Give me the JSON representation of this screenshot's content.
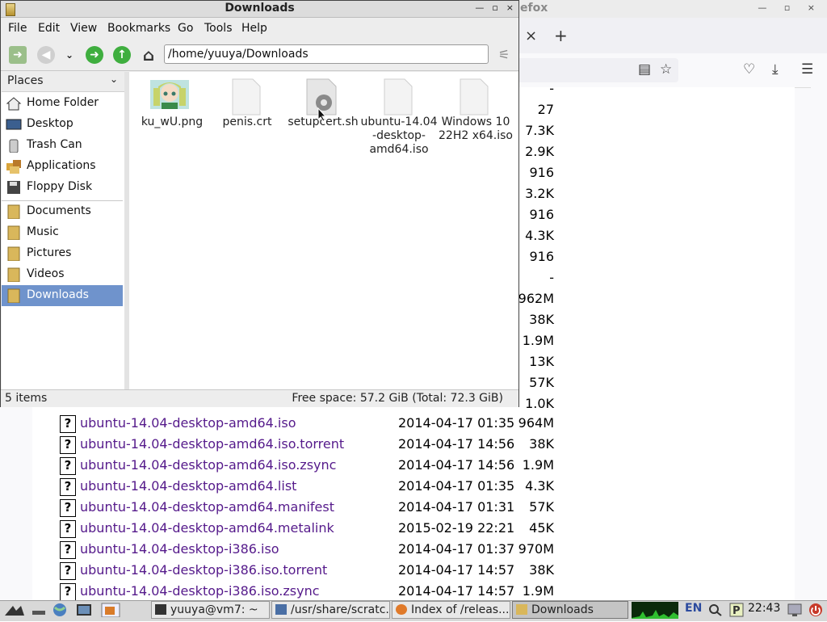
{
  "firefox": {
    "title_visible": "efox",
    "size_column_partial": [
      "-",
      "27",
      "7.3K",
      "2.9K",
      "916",
      "3.2K",
      "916",
      "4.3K",
      "916",
      "-",
      "962M",
      "38K",
      "1.9M",
      "13K",
      "57K",
      "1.0K"
    ],
    "rows": [
      {
        "name": "ubuntu-14.04-desktop-amd64.iso",
        "date": "2014-04-17 01:35",
        "size": "964M"
      },
      {
        "name": "ubuntu-14.04-desktop-amd64.iso.torrent",
        "date": "2014-04-17 14:56",
        "size": "38K"
      },
      {
        "name": "ubuntu-14.04-desktop-amd64.iso.zsync",
        "date": "2014-04-17 14:56",
        "size": "1.9M"
      },
      {
        "name": "ubuntu-14.04-desktop-amd64.list",
        "date": "2014-04-17 01:35",
        "size": "4.3K"
      },
      {
        "name": "ubuntu-14.04-desktop-amd64.manifest",
        "date": "2014-04-17 01:31",
        "size": "57K"
      },
      {
        "name": "ubuntu-14.04-desktop-amd64.metalink",
        "date": "2015-02-19 22:21",
        "size": "45K"
      },
      {
        "name": "ubuntu-14.04-desktop-i386.iso",
        "date": "2014-04-17 01:37",
        "size": "970M"
      },
      {
        "name": "ubuntu-14.04-desktop-i386.iso.torrent",
        "date": "2014-04-17 14:57",
        "size": "38K"
      },
      {
        "name": "ubuntu-14.04-desktop-i386.iso.zsync",
        "date": "2014-04-17 14:57",
        "size": "1.9M"
      }
    ],
    "icons": {
      "reader": "reader-view-icon",
      "bookmark": "bookmark-star-icon",
      "pocket": "pocket-icon",
      "download": "download-arrow-icon",
      "menu": "hamburger-menu-icon"
    }
  },
  "thunar": {
    "title": "Downloads",
    "menu": [
      "File",
      "Edit",
      "View",
      "Bookmarks",
      "Go",
      "Tools",
      "Help"
    ],
    "path": "/home/yuuya/Downloads",
    "places_label": "Places",
    "places": [
      "Home Folder",
      "Desktop",
      "Trash Can",
      "Applications",
      "Floppy Disk"
    ],
    "bookmarks": [
      "Documents",
      "Music",
      "Pictures",
      "Videos",
      "Downloads"
    ],
    "selected_bookmark": "Downloads",
    "files": [
      {
        "line1": "ku_wU.png",
        "line2": "",
        "line3": "",
        "icon": "image-thumbnail"
      },
      {
        "line1": "penis.crt",
        "line2": "",
        "line3": "",
        "icon": "file-icon"
      },
      {
        "line1": "setupcert.sh",
        "line2": "",
        "line3": "",
        "icon": "script-gear-icon"
      },
      {
        "line1": "ubuntu-14.04",
        "line2": "-desktop-",
        "line3": "amd64.iso",
        "icon": "file-icon"
      },
      {
        "line1": "Windows 10",
        "line2": "22H2 x64.iso",
        "line3": "",
        "icon": "file-icon"
      }
    ],
    "status_left": "5 items",
    "status_right": "Free space: 57.2 GiB (Total: 72.3 GiB)"
  },
  "taskbar": {
    "tasks": [
      "yuuya@vm7: ~",
      "/usr/share/scratc...",
      "Index of /releas...",
      "Downloads"
    ],
    "active_task": "Downloads",
    "language": "EN",
    "clock": "22:43"
  },
  "colors": {
    "link": "#551a8b",
    "selection": "#6f93cc",
    "folder": "#d9b75b"
  }
}
